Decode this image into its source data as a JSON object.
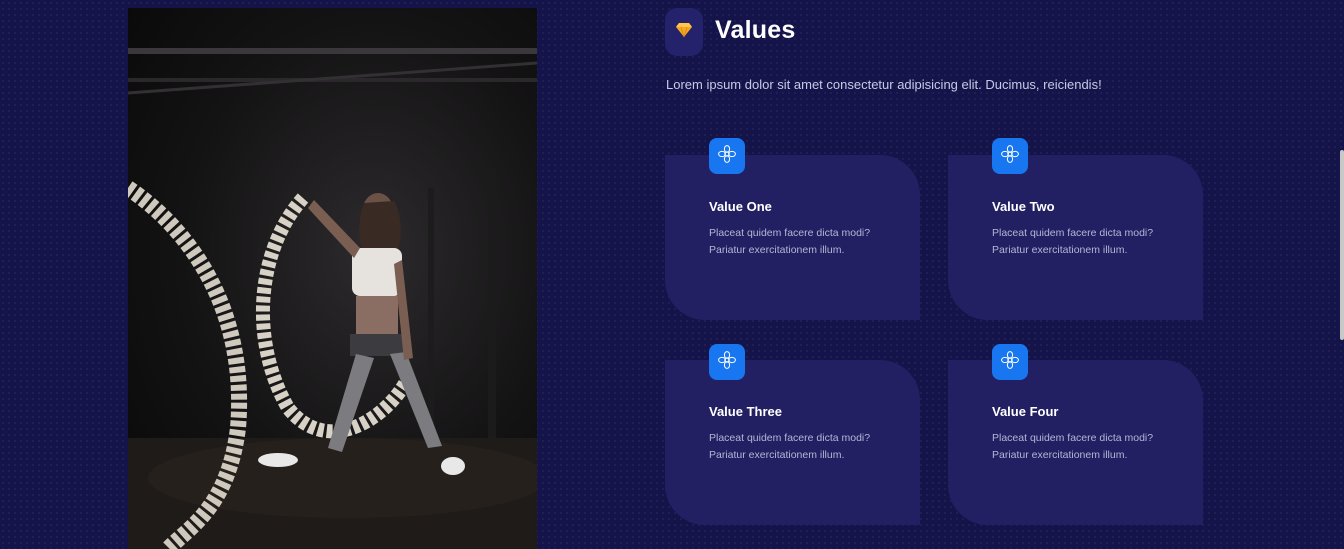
{
  "hero_image": {
    "alt": "Woman training with battle ropes in a gym"
  },
  "values_section": {
    "icon": "diamond-icon",
    "title": "Values",
    "description": "Lorem ipsum dolor sit amet consectetur adipisicing elit. Ducimus, reiciendis!"
  },
  "cards": [
    {
      "icon": "flower-icon",
      "title": "Value One",
      "text": "Placeat quidem facere dicta modi? Pariatur exercitationem illum."
    },
    {
      "icon": "flower-icon",
      "title": "Value Two",
      "text": "Placeat quidem facere dicta modi? Pariatur exercitationem illum."
    },
    {
      "icon": "flower-icon",
      "title": "Value Three",
      "text": "Placeat quidem facere dicta modi? Pariatur exercitationem illum."
    },
    {
      "icon": "flower-icon",
      "title": "Value Four",
      "text": "Placeat quidem facere dicta modi? Pariatur exercitationem illum."
    }
  ],
  "colors": {
    "background": "#15144a",
    "card": "#222062",
    "icon_blue": "#1876f0",
    "diamond": "#f5a623"
  }
}
